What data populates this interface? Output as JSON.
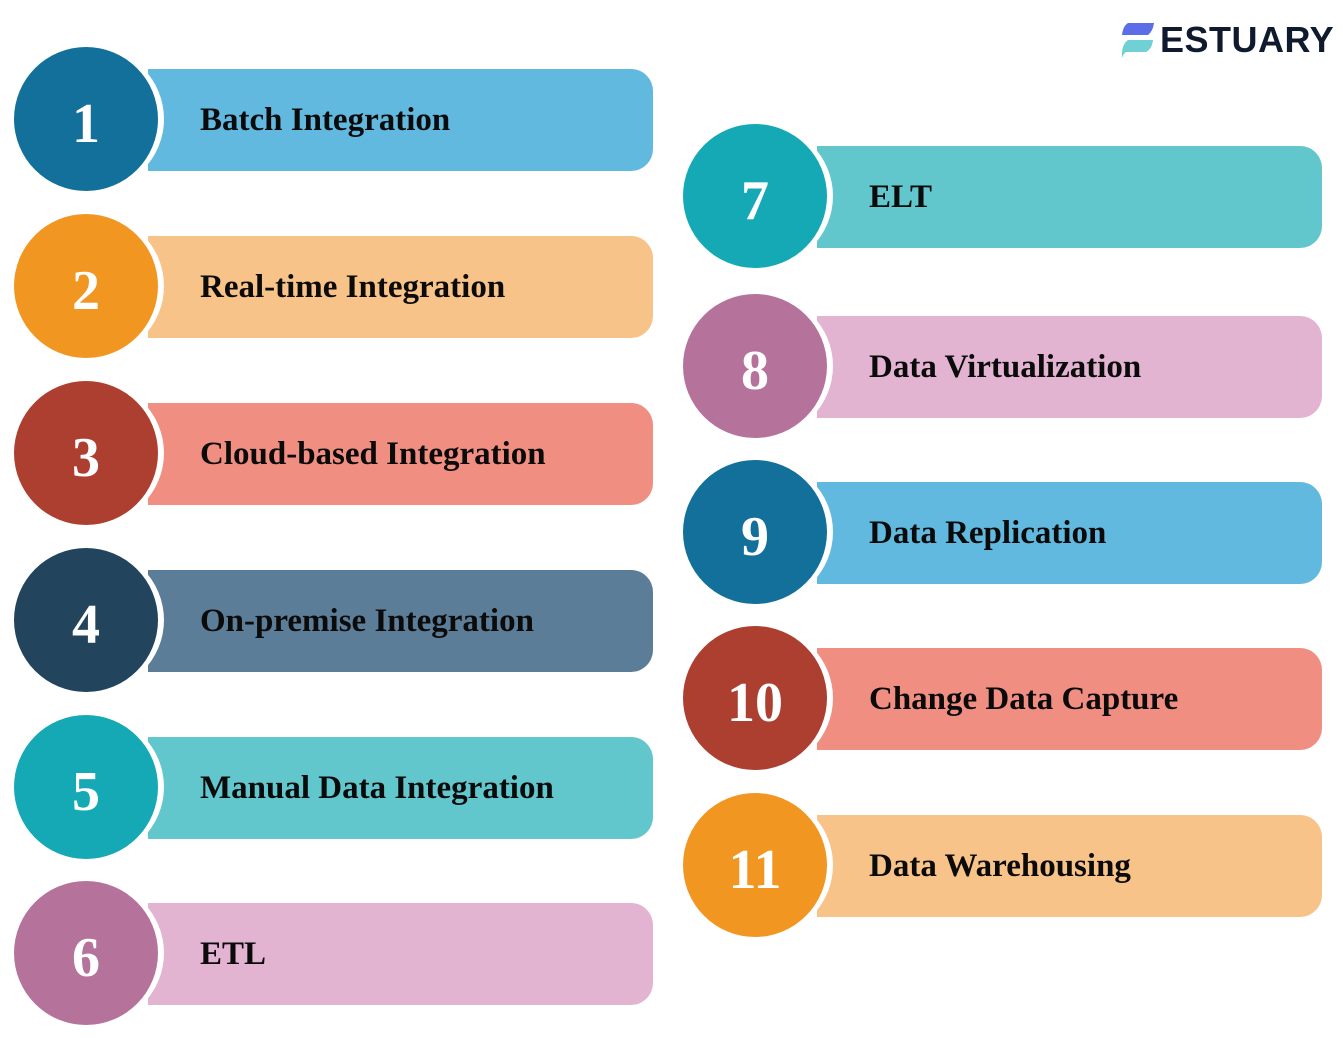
{
  "brand": {
    "name": "ESTUARY",
    "logo_top_color": "#5b6ee8",
    "logo_bottom_color": "#6fd0d6"
  },
  "items": [
    {
      "number": "1",
      "label": "Batch Integration",
      "circle_color": "#12709a",
      "bar_color": "#62b9e0"
    },
    {
      "number": "2",
      "label": "Real-time Integration",
      "circle_color": "#f29622",
      "bar_color": "#f7c388"
    },
    {
      "number": "3",
      "label": "Cloud-based Integration",
      "circle_color": "#ad3f31",
      "bar_color": "#f08e82"
    },
    {
      "number": "4",
      "label": "On-premise Integration",
      "circle_color": "#22445d",
      "bar_color": "#5c7d98"
    },
    {
      "number": "5",
      "label": "Manual Data Integration",
      "circle_color": "#14a9b4",
      "bar_color": "#62c6cd"
    },
    {
      "number": "6",
      "label": "ETL",
      "circle_color": "#b5739c",
      "bar_color": "#e2b4d2"
    },
    {
      "number": "7",
      "label": "ELT",
      "circle_color": "#14a9b4",
      "bar_color": "#62c6cd"
    },
    {
      "number": "8",
      "label": "Data Virtualization",
      "circle_color": "#b5739c",
      "bar_color": "#e2b4d2"
    },
    {
      "number": "9",
      "label": "Data Replication",
      "circle_color": "#12709a",
      "bar_color": "#62b9e0"
    },
    {
      "number": "10",
      "label": "Change Data Capture",
      "circle_color": "#ad3f31",
      "bar_color": "#f08e82"
    },
    {
      "number": "11",
      "label": "Data Warehousing",
      "circle_color": "#f29622",
      "bar_color": "#f7c388"
    }
  ]
}
